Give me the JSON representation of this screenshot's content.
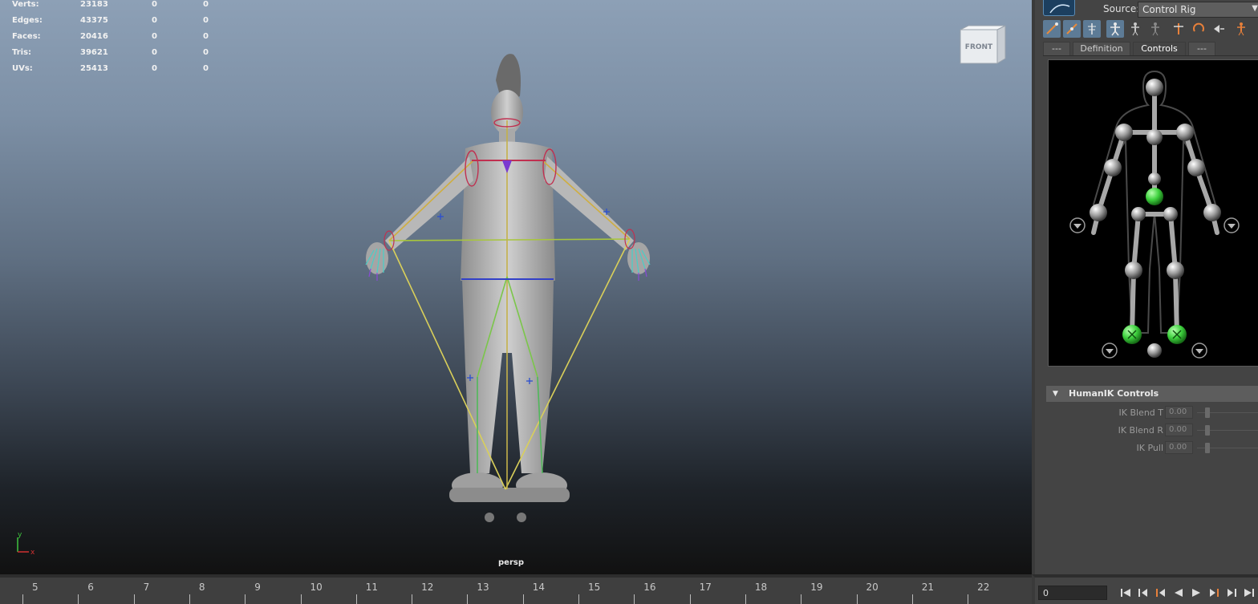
{
  "hud": {
    "rows": [
      {
        "label": "Verts:",
        "v1": "23183",
        "v2": "0",
        "v3": "0"
      },
      {
        "label": "Edges:",
        "v1": "43375",
        "v2": "0",
        "v3": "0"
      },
      {
        "label": "Faces:",
        "v1": "20416",
        "v2": "0",
        "v3": "0"
      },
      {
        "label": "Tris:",
        "v1": "39621",
        "v2": "0",
        "v3": "0"
      },
      {
        "label": "UVs:",
        "v1": "25413",
        "v2": "0",
        "v3": "0"
      }
    ]
  },
  "viewport": {
    "viewcube_label": "FRONT",
    "camera_label": "persp",
    "axis_y": "y",
    "axis_x": "x"
  },
  "panel": {
    "source_label": "Source:",
    "source_value": "Control Rig",
    "toolbar_icons": [
      "full-body-ik-icon",
      "body-part-ik-icon",
      "skeleton-view-icon",
      "select-full-body-icon",
      "select-body-part-icon",
      "select-effector-icon",
      "pin-translate-icon",
      "pin-rotate-icon",
      "release-pin-icon",
      "figure-mode-icon"
    ],
    "tabs": [
      "---",
      "Definition",
      "Controls",
      "---"
    ],
    "active_tab": "Controls",
    "section_title": "HumanIK Controls",
    "controls": [
      {
        "label": "IK Blend T",
        "value": "0.00"
      },
      {
        "label": "IK Blend R",
        "value": "0.00"
      },
      {
        "label": "IK Pull",
        "value": "0.00"
      }
    ],
    "accent_color": "#5d7b96",
    "effector_active_color": "#3fd23f"
  },
  "timeline": {
    "ticks": [
      "5",
      "6",
      "7",
      "8",
      "9",
      "10",
      "11",
      "12",
      "13",
      "14",
      "15",
      "16",
      "17",
      "18",
      "19",
      "20",
      "21",
      "22"
    ],
    "current_frame": "0"
  }
}
